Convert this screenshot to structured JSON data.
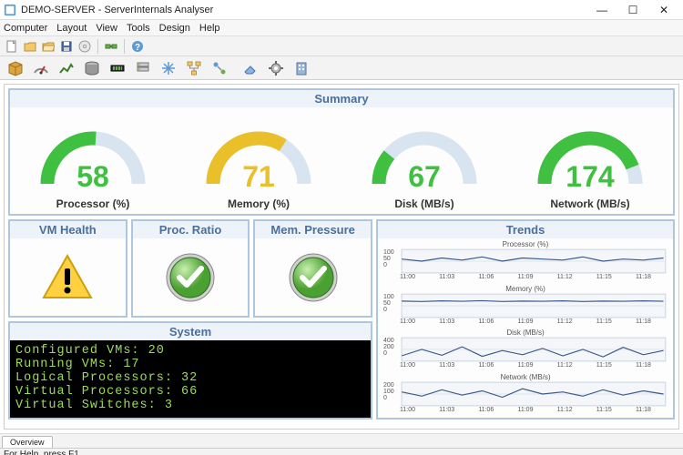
{
  "window": {
    "title": "DEMO-SERVER - ServerInternals Analyser"
  },
  "menubar": [
    "Computer",
    "Layout",
    "View",
    "Tools",
    "Design",
    "Help"
  ],
  "statusbar": "For Help, press F1.",
  "tabs": [
    "Overview"
  ],
  "summary": {
    "title": "Summary",
    "gauges": [
      {
        "label": "Processor (%)",
        "value": 58,
        "max": 100,
        "fillPct": 52,
        "color": "#40c040"
      },
      {
        "label": "Memory (%)",
        "value": 71,
        "max": 100,
        "fillPct": 68,
        "color": "#e9c02a"
      },
      {
        "label": "Disk (MB/s)",
        "value": 67,
        "max": 400,
        "fillPct": 22,
        "color": "#40c040"
      },
      {
        "label": "Network (MB/s)",
        "value": 174,
        "max": 200,
        "fillPct": 88,
        "color": "#40c040"
      }
    ]
  },
  "status_panels": [
    {
      "title": "VM Health",
      "state": "warning"
    },
    {
      "title": "Proc. Ratio",
      "state": "ok"
    },
    {
      "title": "Mem. Pressure",
      "state": "ok"
    }
  ],
  "system": {
    "title": "System",
    "lines": [
      "Configured VMs: 20",
      "Running VMs: 17",
      "Logical Processors: 32",
      "Virtual Processors: 66",
      "Virtual Switches: 3"
    ]
  },
  "trends": {
    "title": "Trends",
    "x_ticks": [
      "11:00",
      "11:03",
      "11:06",
      "11:09",
      "11:12",
      "11:15",
      "11:18"
    ],
    "series": [
      {
        "title": "Processor (%)",
        "ymax": 100,
        "yticks": [
          "100",
          "50",
          "0"
        ]
      },
      {
        "title": "Memory (%)",
        "ymax": 100,
        "yticks": [
          "100",
          "50",
          "0"
        ]
      },
      {
        "title": "Disk (MB/s)",
        "ymax": 400,
        "yticks": [
          "400",
          "200",
          "0"
        ]
      },
      {
        "title": "Network (MB/s)",
        "ymax": 200,
        "yticks": [
          "200",
          "100",
          "0"
        ]
      }
    ]
  },
  "chart_data": [
    {
      "type": "line",
      "title": "Processor (%)",
      "ylim": [
        0,
        100
      ],
      "x": [
        "11:00",
        "11:03",
        "11:06",
        "11:09",
        "11:12",
        "11:15",
        "11:18"
      ],
      "values": [
        60,
        50,
        65,
        55,
        70,
        50,
        65,
        60,
        55,
        70,
        50,
        60,
        55,
        65
      ]
    },
    {
      "type": "line",
      "title": "Memory (%)",
      "ylim": [
        0,
        100
      ],
      "x": [
        "11:00",
        "11:03",
        "11:06",
        "11:09",
        "11:12",
        "11:15",
        "11:18"
      ],
      "values": [
        72,
        70,
        73,
        71,
        74,
        70,
        72,
        71,
        73,
        70,
        72,
        71,
        73,
        71
      ]
    },
    {
      "type": "line",
      "title": "Disk (MB/s)",
      "ylim": [
        0,
        400
      ],
      "x": [
        "11:00",
        "11:03",
        "11:06",
        "11:09",
        "11:12",
        "11:15",
        "11:18"
      ],
      "values": [
        80,
        200,
        90,
        250,
        70,
        180,
        100,
        220,
        80,
        200,
        60,
        240,
        100,
        180
      ]
    },
    {
      "type": "line",
      "title": "Network (MB/s)",
      "ylim": [
        0,
        200
      ],
      "x": [
        "11:00",
        "11:03",
        "11:06",
        "11:09",
        "11:12",
        "11:15",
        "11:18"
      ],
      "values": [
        120,
        80,
        140,
        90,
        130,
        70,
        150,
        100,
        120,
        80,
        140,
        90,
        130,
        100
      ]
    }
  ]
}
